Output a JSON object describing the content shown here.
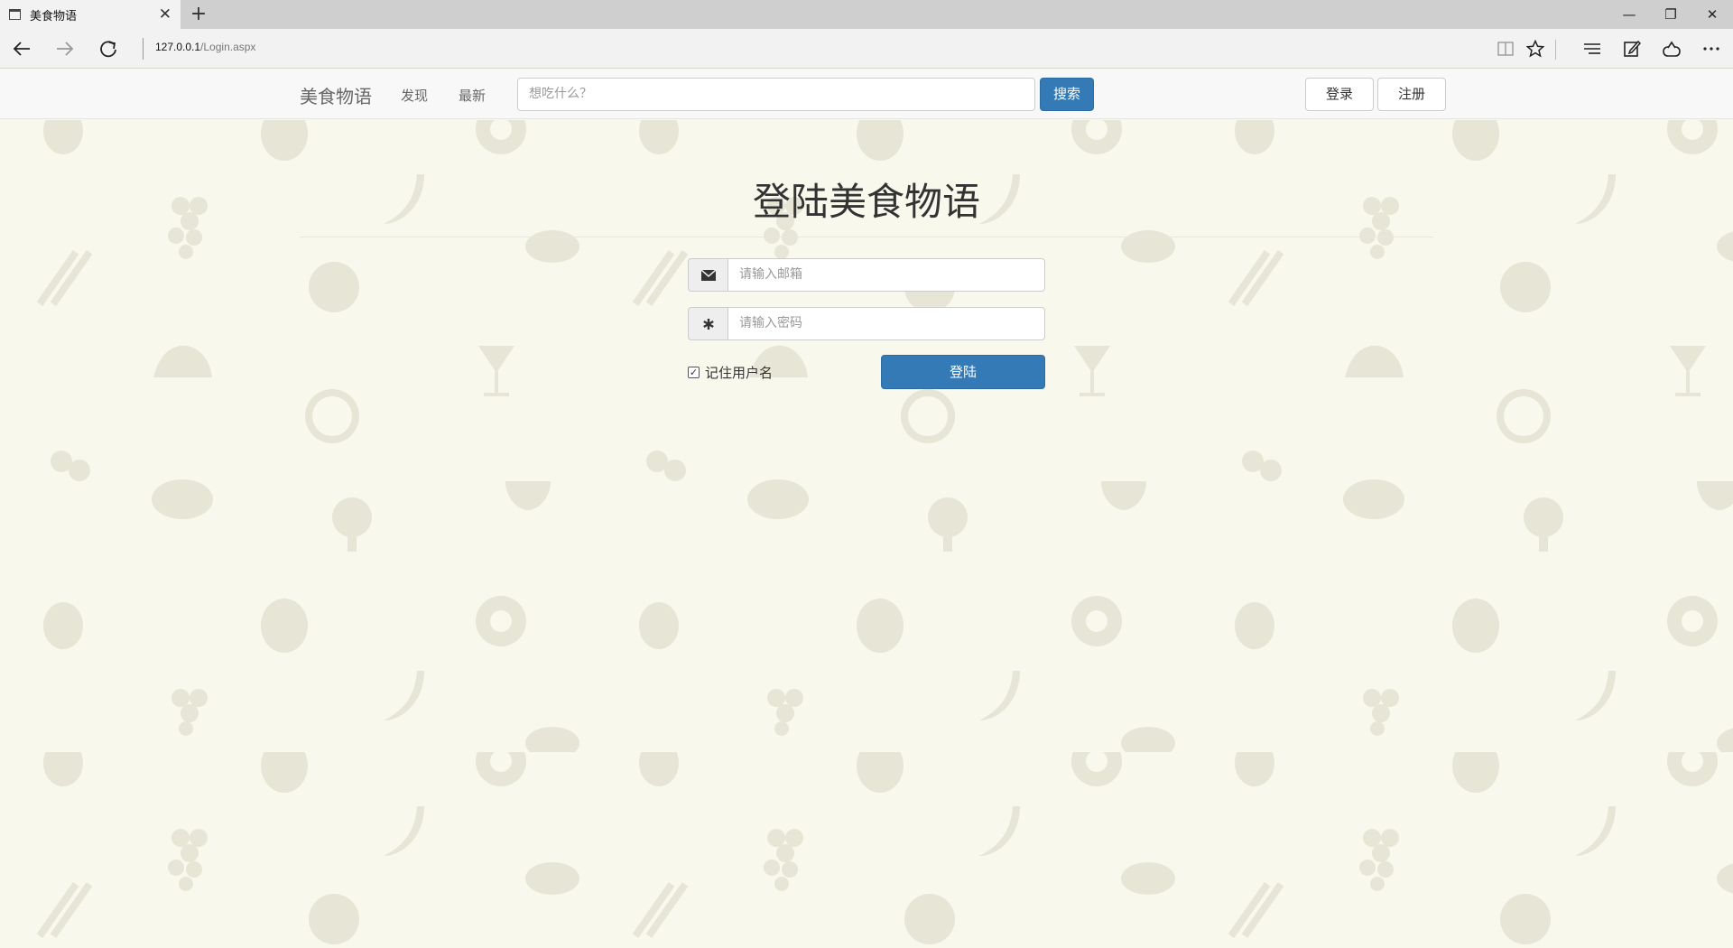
{
  "browser": {
    "tab_title": "美食物语",
    "new_tab": "+",
    "tab_close": "✕",
    "address_host": "127.0.0.1",
    "address_path": "/Login.aspx",
    "icons": [
      "back-icon",
      "forward-icon",
      "refresh-icon",
      "reading-view-icon",
      "favorite-star-icon",
      "hub-icon",
      "web-note-icon",
      "share-icon",
      "more-icon"
    ]
  },
  "window": {
    "minimize": "—",
    "restore": "❐",
    "close": "✕"
  },
  "header": {
    "brand": "美食物语",
    "nav": [
      {
        "label": "发现"
      },
      {
        "label": "最新"
      }
    ],
    "search_placeholder": "想吃什么？",
    "search_button": "搜索",
    "login_button": "登录",
    "register_button": "注册"
  },
  "login": {
    "title": "登陆美食物语",
    "email_placeholder": "请输入邮箱",
    "password_placeholder": "请输入密码",
    "remember_label": "记住用户名",
    "remember_checked": true,
    "submit": "登陆"
  },
  "colors": {
    "primary": "#337ab7",
    "page_bg": "#f9f8ec",
    "pattern": "#e6e5d6"
  }
}
